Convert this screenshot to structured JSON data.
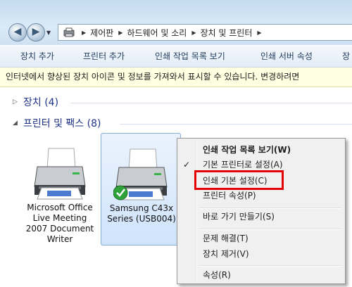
{
  "address_bar": {
    "crumbs": [
      "제어판",
      "하드웨어 및 소리",
      "장치 및 프린터"
    ]
  },
  "toolbar": {
    "add_device": "장치 추가",
    "add_printer": "프린터 추가",
    "see_print_queue": "인쇄 작업 목록 보기",
    "print_server_props": "인쇄 서버 속성",
    "overflow": "장"
  },
  "info_bar": {
    "text": "인터넷에서 향상된 장치 아이콘 및 정보를 가져와서 표시할 수 있습니다. 변경하려면"
  },
  "groups": {
    "devices": "장치 (4)",
    "printers_faxes": "프린터 및 팩스 (8)"
  },
  "devices": [
    {
      "name_lines": [
        "Microsoft Office",
        "Live Meeting",
        "2007 Document",
        "Writer"
      ],
      "selected": false,
      "is_default": false
    },
    {
      "name_lines": [
        "Samsung C43x",
        "Series (USB004)"
      ],
      "selected": true,
      "is_default": true
    }
  ],
  "context_menu": {
    "items": [
      {
        "label": "인쇄 작업 목록 보기(W)",
        "bold": true
      },
      {
        "label": "기본 프린터로 설정(A)",
        "checked": true
      },
      {
        "label": "인쇄 기본 설정(C)",
        "highlighted": true
      },
      {
        "label": "프린터 속성(P)"
      },
      {
        "label": "바로 가기 만들기(S)"
      },
      {
        "label": "문제 해결(T)"
      },
      {
        "label": "장치 제거(V)"
      },
      {
        "label": "속성(R)"
      }
    ]
  },
  "colors": {
    "highlight_box": "#e50000",
    "group_label": "#1e3287",
    "info_bar_bg": "#ffffe1",
    "selection_bg": "#cfe3fb"
  }
}
